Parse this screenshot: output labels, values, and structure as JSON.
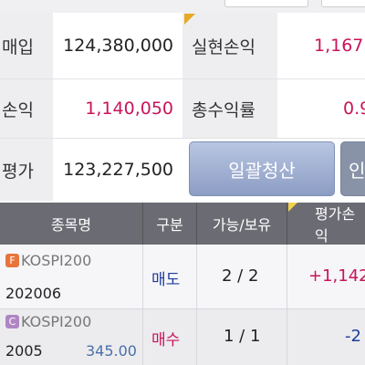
{
  "summary": {
    "buy_label": "매입",
    "buy_value": "124,380,000",
    "realized_label": "실현손익",
    "realized_value": "1,167,",
    "pnl_label": "손익",
    "pnl_value": "1,140,050",
    "total_return_label": "총수익률",
    "total_return_value": "0.9",
    "eval_label": "평가",
    "eval_value": "123,227,500"
  },
  "buttons": {
    "liquidate_all": "일괄청산",
    "second": "인"
  },
  "table": {
    "headers": [
      "종목명",
      "구분",
      "가능/보유",
      "평가손익"
    ],
    "rows": [
      {
        "badge": "F",
        "badge_color": "#e8743c",
        "name": "KOSPI200",
        "code": "202006",
        "price": "",
        "side": "매도",
        "side_color": "#1f3c9a",
        "qty": "2 / 2",
        "pnl": "+1,142",
        "pnl_color": "#c8145a"
      },
      {
        "badge": "C",
        "badge_color": "#b085c4",
        "name": "KOSPI200",
        "code": "2005",
        "price": "345.00",
        "side": "매수",
        "side_color": "#c8145a",
        "qty": "1 / 1",
        "pnl": "-2",
        "pnl_color": "#1f3c9a"
      }
    ]
  }
}
